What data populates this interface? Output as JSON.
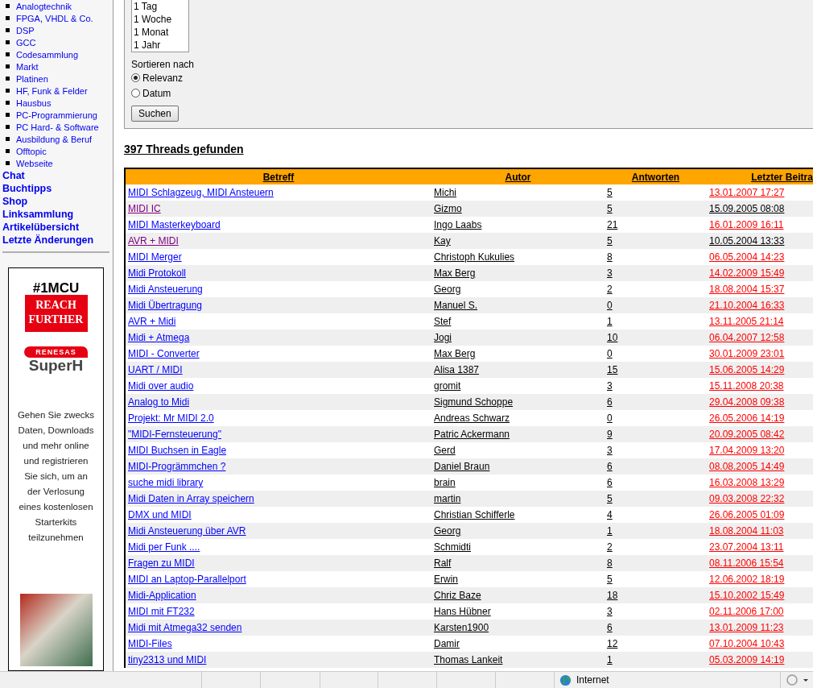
{
  "sidebar": {
    "forum_links": [
      "Analogtechnik",
      "FPGA, VHDL & Co.",
      "DSP",
      "GCC",
      "Codesammlung",
      "Markt",
      "Platinen",
      "HF, Funk & Felder",
      "Hausbus",
      "PC-Programmierung",
      "PC Hard- & Software",
      "Ausbildung & Beruf",
      "Offtopic",
      "Webseite"
    ],
    "main_links": [
      "Chat",
      "Buchtipps",
      "Shop",
      "Linksammlung",
      "Artikelübersicht",
      "Letzte Änderungen"
    ]
  },
  "ad": {
    "badge_top": "#1MCU",
    "badge_lines": [
      "REACH",
      "FURTHER"
    ],
    "brand": "RENESAS",
    "product": "SuperH",
    "text": "Gehen Sie zwecks Daten, Downloads und mehr online und registrieren Sie sich, um an der Verlosung eines kostenlosen Starterkits teilzunehmen"
  },
  "search_form": {
    "time_options": [
      "1 Tag",
      "1 Woche",
      "1 Monat",
      "1 Jahr"
    ],
    "sort_label": "Sortieren nach",
    "sort_options": [
      {
        "label": "Relevanz",
        "selected": true
      },
      {
        "label": "Datum",
        "selected": false
      }
    ],
    "submit": "Suchen"
  },
  "results_heading": "397 Threads gefunden",
  "table": {
    "columns": [
      "Betreff",
      "Autor",
      "Antworten",
      "Letzter Beitra"
    ],
    "rows": [
      {
        "subject": "MIDI Schlagzeug, MIDI Ansteuern",
        "visited": false,
        "author": "Michi",
        "replies": "5",
        "last_post": "13.01.2007 17:27",
        "new": true
      },
      {
        "subject": "MIDI IC",
        "visited": true,
        "author": "Gizmo",
        "replies": "5",
        "last_post": "15.09.2005 08:08",
        "new": false
      },
      {
        "subject": "MIDI Masterkeyboard",
        "visited": false,
        "author": "Ingo Laabs",
        "replies": "21",
        "last_post": "16.01.2009 16:11",
        "new": true
      },
      {
        "subject": "AVR + MIDI",
        "visited": true,
        "author": "Kay",
        "replies": "5",
        "last_post": "10.05.2004 13:33",
        "new": false
      },
      {
        "subject": "MIDI Merger",
        "visited": false,
        "author": "Christoph Kukulies",
        "replies": "8",
        "last_post": "06.05.2004 14:23",
        "new": true
      },
      {
        "subject": "Midi Protokoll",
        "visited": false,
        "author": "Max Berg",
        "replies": "3",
        "last_post": "14.02.2009 15:49",
        "new": true
      },
      {
        "subject": "Midi Ansteuerung",
        "visited": false,
        "author": "Georg",
        "replies": "2",
        "last_post": "18.08.2004 15:37",
        "new": true
      },
      {
        "subject": "Midi Übertragung",
        "visited": false,
        "author": "Manuel S.",
        "replies": "0",
        "last_post": "21.10.2004 16:33",
        "new": true
      },
      {
        "subject": "AVR + Midi",
        "visited": false,
        "author": "Stef",
        "replies": "1",
        "last_post": "13.11.2005 21:14",
        "new": true
      },
      {
        "subject": "Midi + Atmega",
        "visited": false,
        "author": "Jogi",
        "replies": "10",
        "last_post": "06.04.2007 12:58",
        "new": true
      },
      {
        "subject": "MIDI - Converter",
        "visited": false,
        "author": "Max Berg",
        "replies": "0",
        "last_post": "30.01.2009 23:01",
        "new": true
      },
      {
        "subject": "UART / MIDI",
        "visited": false,
        "author": "Alisa 1387",
        "replies": "15",
        "last_post": "15.06.2005 14:29",
        "new": true
      },
      {
        "subject": "Midi over audio",
        "visited": false,
        "author": "gromit",
        "replies": "3",
        "last_post": "15.11.2008 20:38",
        "new": true
      },
      {
        "subject": "Analog to Midi",
        "visited": false,
        "author": "Sigmund Schoppe",
        "replies": "6",
        "last_post": "29.04.2008 09:38",
        "new": true
      },
      {
        "subject": "Projekt: Mr MIDI 2.0",
        "visited": false,
        "author": "Andreas Schwarz",
        "replies": "0",
        "last_post": "26.05.2006 14:19",
        "new": true
      },
      {
        "subject": "\"MIDI-Fernsteuerung\"",
        "visited": false,
        "author": "Patric Ackermann",
        "replies": "9",
        "last_post": "20.09.2005 08:42",
        "new": true
      },
      {
        "subject": "MIDI Buchsen in Eagle",
        "visited": false,
        "author": "Gerd",
        "replies": "3",
        "last_post": "17.04.2009 13:20",
        "new": true
      },
      {
        "subject": "MIDI-Progrämmchen ?",
        "visited": false,
        "author": "Daniel Braun",
        "replies": "6",
        "last_post": "08.08.2005 14:49",
        "new": true
      },
      {
        "subject": "suche midi library",
        "visited": false,
        "author": "brain",
        "replies": "6",
        "last_post": "16.03.2008 13:29",
        "new": true
      },
      {
        "subject": "Midi Daten in Array speichern",
        "visited": false,
        "author": "martin",
        "replies": "5",
        "last_post": "09.03.2008 22:32",
        "new": true
      },
      {
        "subject": "DMX und MIDI",
        "visited": false,
        "author": "Christian Schifferle",
        "replies": "4",
        "last_post": "26.06.2005 01:09",
        "new": true
      },
      {
        "subject": "Midi Ansteuerung über AVR",
        "visited": false,
        "author": "Georg",
        "replies": "1",
        "last_post": "18.08.2004 11:03",
        "new": true
      },
      {
        "subject": "Midi per Funk ....",
        "visited": false,
        "author": "Schmidti",
        "replies": "2",
        "last_post": "23.07.2004 13:11",
        "new": true
      },
      {
        "subject": "Fragen zu MIDI",
        "visited": false,
        "author": "Ralf",
        "replies": "8",
        "last_post": "08.11.2006 15:54",
        "new": true
      },
      {
        "subject": "MIDI an Laptop-Parallelport",
        "visited": false,
        "author": "Erwin",
        "replies": "5",
        "last_post": "12.06.2002 18:19",
        "new": true
      },
      {
        "subject": "Midi-Application",
        "visited": false,
        "author": "Chriz Baze",
        "replies": "18",
        "last_post": "15.10.2002 15:49",
        "new": true
      },
      {
        "subject": "MIDI mit FT232",
        "visited": false,
        "author": "Hans Hübner",
        "replies": "3",
        "last_post": "02.11.2006 17:00",
        "new": true
      },
      {
        "subject": "Midi mit Atmega32 senden",
        "visited": false,
        "author": "Karsten1900",
        "replies": "6",
        "last_post": "13.01.2009 11:23",
        "new": true
      },
      {
        "subject": "MIDI-Files",
        "visited": false,
        "author": "Damir",
        "replies": "12",
        "last_post": "07.10.2004 10:43",
        "new": true
      },
      {
        "subject": "tiny2313 und MIDI",
        "visited": false,
        "author": "Thomas Lankeit",
        "replies": "1",
        "last_post": "05.03.2009 14:19",
        "new": true
      }
    ]
  },
  "status_bar": {
    "zone": "Internet"
  }
}
